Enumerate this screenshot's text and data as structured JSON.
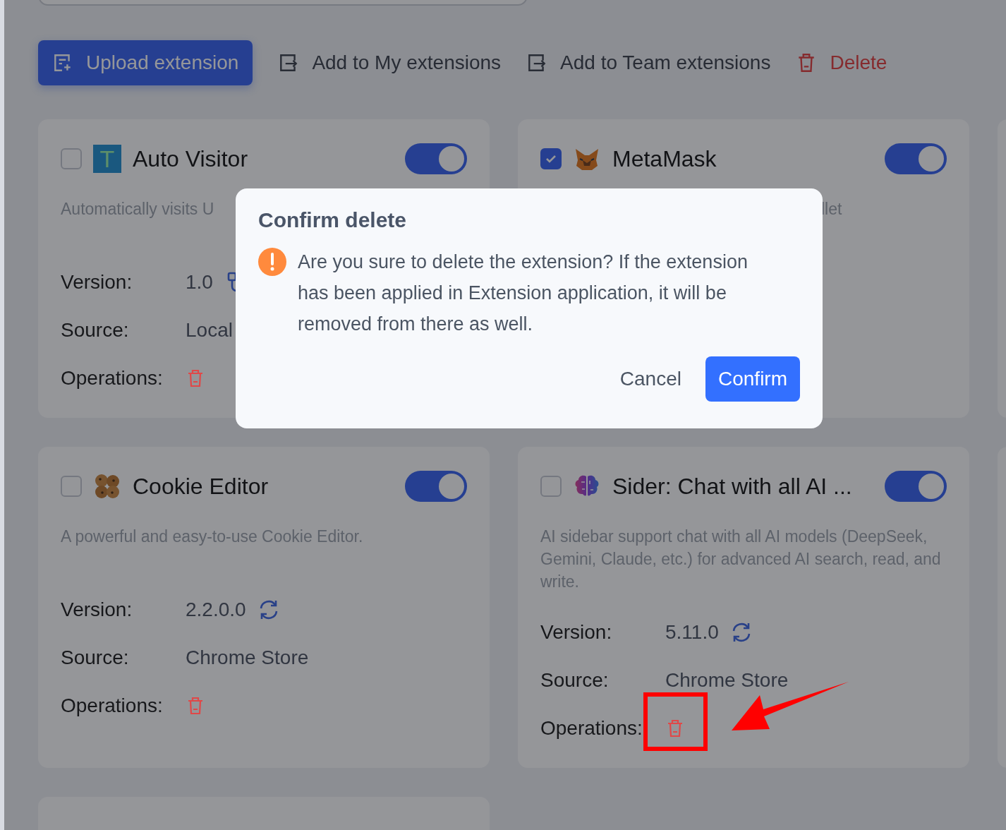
{
  "toolbar": [
    {
      "kind": "primary",
      "label": "Upload extension"
    },
    {
      "kind": "plain",
      "label": "Add to My extensions"
    },
    {
      "kind": "plain",
      "label": "Add to Team extensions"
    },
    {
      "kind": "danger",
      "label": "Delete"
    }
  ],
  "cards": [
    {
      "title": "Auto Visitor",
      "kind": "letter",
      "logo_text": "T",
      "selected": false,
      "enabled": true,
      "description": "Automatically visits U",
      "description_cut_left": false,
      "rows": [
        {
          "kind": "version-link",
          "label": "Version:",
          "value": "1.0"
        },
        {
          "kind": "text",
          "label": "Source:",
          "value": "Local"
        },
        {
          "kind": "operations",
          "label": "Operations:"
        }
      ]
    },
    {
      "title": "MetaMask",
      "kind": "fox",
      "selected": true,
      "enabled": true,
      "description": "llet",
      "description_cut_left": true
    },
    {
      "title": "Cookie Editor",
      "kind": "cookies",
      "selected": false,
      "enabled": true,
      "description": "A powerful and easy-to-use Cookie Editor.",
      "description_cut_left": false,
      "rows": [
        {
          "kind": "version-refresh",
          "label": "Version:",
          "value": "2.2.0.0"
        },
        {
          "kind": "text",
          "label": "Source:",
          "value": "Chrome Store"
        },
        {
          "kind": "operations",
          "label": "Operations:"
        }
      ]
    },
    {
      "title": "Sider: Chat with all AI ...",
      "kind": "brain",
      "selected": false,
      "enabled": true,
      "description": "AI sidebar support chat with all AI models (DeepSeek, Gemini, Claude, etc.) for advanced AI search, read, and write.",
      "description_cut_left": false,
      "rows": [
        {
          "kind": "version-refresh",
          "label": "Version:",
          "value": "5.11.0"
        },
        {
          "kind": "text",
          "label": "Source:",
          "value": "Chrome Store"
        },
        {
          "kind": "operations",
          "label": "Operations:",
          "highlighted": true
        }
      ]
    }
  ],
  "dialog": {
    "title": "Confirm delete",
    "message": "Are you sure to delete the extension? If the extension has been applied in Extension application, it will be removed from there as well.",
    "cancel": "Cancel",
    "confirm": "Confirm"
  }
}
